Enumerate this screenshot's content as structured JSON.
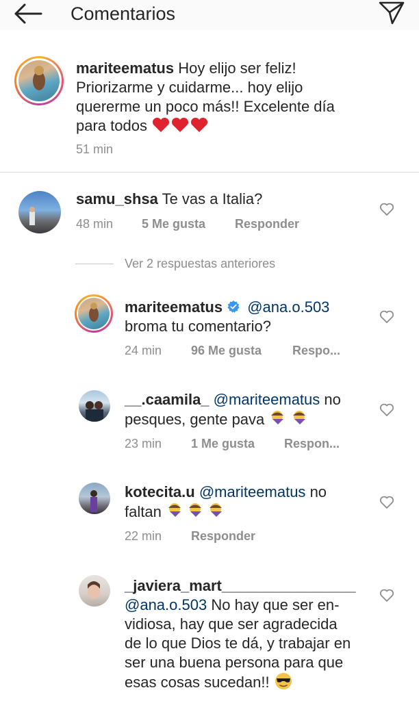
{
  "header": {
    "title": "Comentarios",
    "back_icon": "arrow-left-icon",
    "send_icon": "paper-plane-icon"
  },
  "caption": {
    "user": "mariteematus",
    "line1": "Hoy elijo ser feliz!",
    "line2": "Priorizarme y cuidarme... hoy elijo",
    "line3": "quererme un poco más!! Excelente día",
    "line4": "para todos",
    "time": "51 min"
  },
  "comments": [
    {
      "user": "samu_shsa",
      "text": "Te vas a Italia?",
      "time": "48 min",
      "likes": "5 Me gusta",
      "reply": "Responder"
    }
  ],
  "view_replies": "Ver 2 respuestas anteriores",
  "replies": [
    {
      "user": "mariteematus",
      "mention": "@ana.o.503",
      "line2": "broma tu comentario?",
      "time": "24 min",
      "likes": "96 Me gusta",
      "reply": "Respo..."
    },
    {
      "user": "__.caamila_",
      "mention": "@mariteematus",
      "text_end": "no",
      "line2": "pesques, gente pava",
      "time": "23 min",
      "likes": "1 Me gusta",
      "reply": "Respon..."
    },
    {
      "user": "kotecita.u",
      "mention": "@mariteematus",
      "text_end": "no",
      "line2": "faltan",
      "time": "22 min",
      "reply": "Responder"
    },
    {
      "user": "_javiera_mart________________",
      "mention": "@ana.o.503",
      "line1_end": "No hay que ser en-",
      "line2": "vidiosa, hay que ser agradecida",
      "line3": "de lo que Dios te dá, y trabajar en",
      "line4": "ser una buena persona para que",
      "line5": "esas cosas sucedan!!"
    }
  ],
  "colors": {
    "mention": "#003569",
    "meta": "#8e8e8e",
    "heart_red": "#e0242f"
  }
}
